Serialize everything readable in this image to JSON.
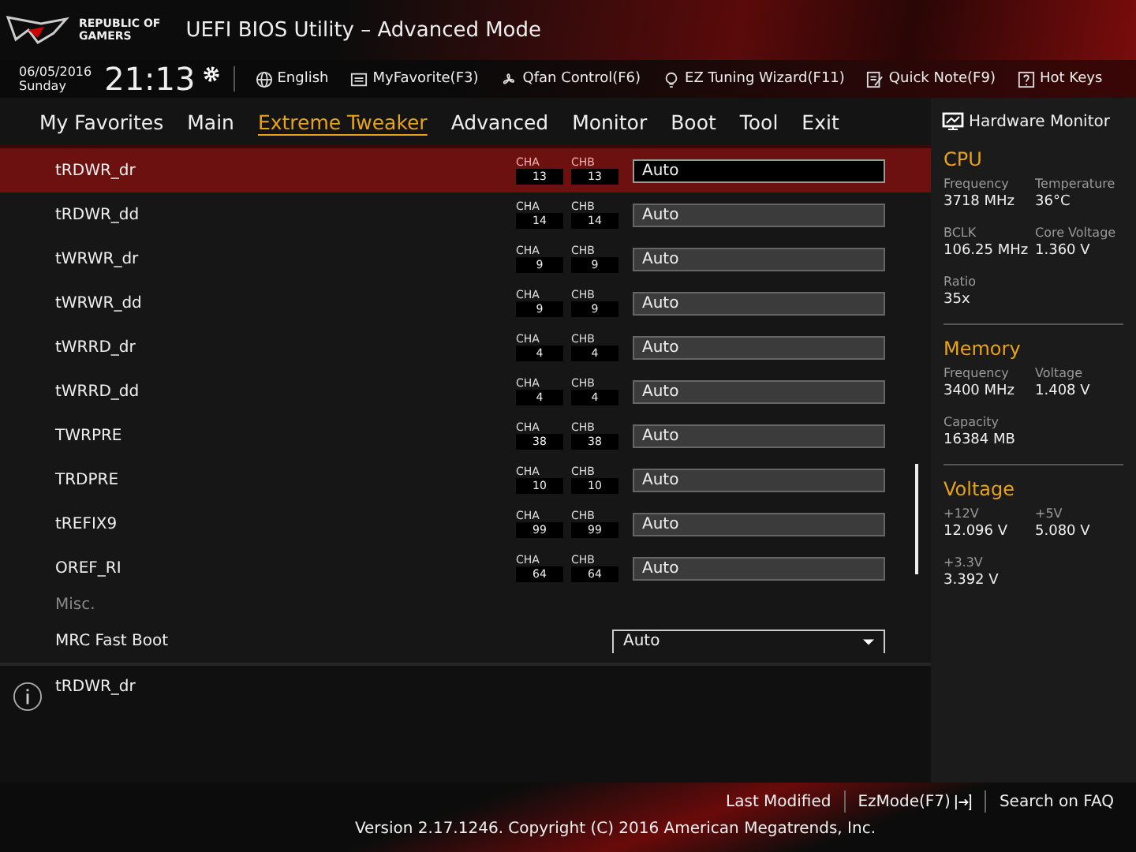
{
  "header": {
    "logo_lines": [
      "REPUBLIC OF",
      "GAMERS"
    ],
    "title": "UEFI BIOS Utility – Advanced Mode"
  },
  "toolbar": {
    "date": "06/05/2016",
    "day": "Sunday",
    "time": "21:13",
    "items": [
      {
        "kind": "globe",
        "label": "English"
      },
      {
        "kind": "favorite",
        "label": "MyFavorite(F3)"
      },
      {
        "kind": "fan",
        "label": "Qfan Control(F6)"
      },
      {
        "kind": "bulb",
        "label": "EZ Tuning Wizard(F11)"
      },
      {
        "kind": "note",
        "label": "Quick Note(F9)"
      },
      {
        "kind": "help",
        "label": "Hot Keys"
      }
    ]
  },
  "tabs": [
    {
      "label": "My Favorites",
      "selected": false
    },
    {
      "label": "Main",
      "selected": false
    },
    {
      "label": "Extreme Tweaker",
      "selected": true
    },
    {
      "label": "Advanced",
      "selected": false
    },
    {
      "label": "Monitor",
      "selected": false
    },
    {
      "label": "Boot",
      "selected": false
    },
    {
      "label": "Tool",
      "selected": false
    },
    {
      "label": "Exit",
      "selected": false
    }
  ],
  "settings": [
    {
      "kind": "timing",
      "name": "tRDWR_dr",
      "cha_label": "CHA",
      "cha": "13",
      "chb_label": "CHB",
      "chb": "13",
      "value": "Auto",
      "selected": true
    },
    {
      "kind": "timing",
      "name": "tRDWR_dd",
      "cha_label": "CHA",
      "cha": "14",
      "chb_label": "CHB",
      "chb": "14",
      "value": "Auto",
      "selected": false
    },
    {
      "kind": "timing",
      "name": "tWRWR_dr",
      "cha_label": "CHA",
      "cha": "9",
      "chb_label": "CHB",
      "chb": "9",
      "value": "Auto",
      "selected": false
    },
    {
      "kind": "timing",
      "name": "tWRWR_dd",
      "cha_label": "CHA",
      "cha": "9",
      "chb_label": "CHB",
      "chb": "9",
      "value": "Auto",
      "selected": false
    },
    {
      "kind": "timing",
      "name": "tWRRD_dr",
      "cha_label": "CHA",
      "cha": "4",
      "chb_label": "CHB",
      "chb": "4",
      "value": "Auto",
      "selected": false
    },
    {
      "kind": "timing",
      "name": "tWRRD_dd",
      "cha_label": "CHA",
      "cha": "4",
      "chb_label": "CHB",
      "chb": "4",
      "value": "Auto",
      "selected": false
    },
    {
      "kind": "timing",
      "name": "TWRPRE",
      "cha_label": "CHA",
      "cha": "38",
      "chb_label": "CHB",
      "chb": "38",
      "value": "Auto",
      "selected": false
    },
    {
      "kind": "timing",
      "name": "TRDPRE",
      "cha_label": "CHA",
      "cha": "10",
      "chb_label": "CHB",
      "chb": "10",
      "value": "Auto",
      "selected": false
    },
    {
      "kind": "timing",
      "name": "tREFIX9",
      "cha_label": "CHA",
      "cha": "99",
      "chb_label": "CHB",
      "chb": "99",
      "value": "Auto",
      "selected": false
    },
    {
      "kind": "timing",
      "name": "OREF_RI",
      "cha_label": "CHA",
      "cha": "64",
      "chb_label": "CHB",
      "chb": "64",
      "value": "Auto",
      "selected": false
    },
    {
      "kind": "section",
      "name": "Misc."
    },
    {
      "kind": "dropdown",
      "name": "MRC Fast Boot",
      "value": "Auto",
      "selected": false
    }
  ],
  "help": {
    "text": "tRDWR_dr"
  },
  "hardware_monitor": {
    "title": "Hardware Monitor",
    "sections": [
      {
        "title": "CPU",
        "items": [
          {
            "label": "Frequency",
            "value": "3718 MHz"
          },
          {
            "label": "Temperature",
            "value": "36°C"
          },
          {
            "label": "BCLK",
            "value": "106.25 MHz"
          },
          {
            "label": "Core Voltage",
            "value": "1.360 V"
          },
          {
            "label": "Ratio",
            "value": "35x"
          }
        ]
      },
      {
        "title": "Memory",
        "items": [
          {
            "label": "Frequency",
            "value": "3400 MHz"
          },
          {
            "label": "Voltage",
            "value": "1.408 V"
          },
          {
            "label": "Capacity",
            "value": "16384 MB"
          }
        ]
      },
      {
        "title": "Voltage",
        "items": [
          {
            "label": "+12V",
            "value": "12.096 V"
          },
          {
            "label": "+5V",
            "value": "5.080 V"
          },
          {
            "label": "+3.3V",
            "value": "3.392 V"
          }
        ]
      }
    ]
  },
  "footer": {
    "links": [
      {
        "kind": "text",
        "label": "Last Modified"
      },
      {
        "kind": "exit",
        "label": "EzMode(F7)"
      },
      {
        "kind": "text",
        "label": "Search on FAQ"
      }
    ],
    "version": "Version 2.17.1246. Copyright (C) 2016 American Megatrends, Inc."
  }
}
